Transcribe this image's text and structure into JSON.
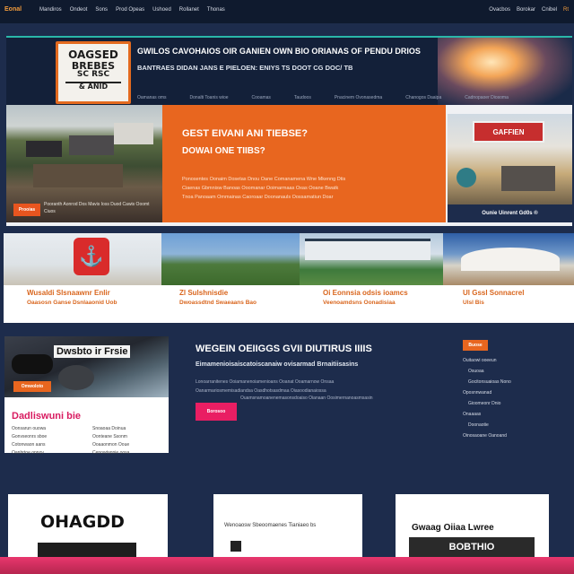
{
  "topbar": {
    "logo": "Eonal",
    "nav": [
      "Mandiros",
      "Ondeot",
      "Sons",
      "Prod Opeas",
      "Ushoed",
      "Rollanet",
      "Thonas"
    ],
    "right": [
      "Ovacbos",
      "Borokar",
      "Cnibel"
    ],
    "right_accent": "Rt"
  },
  "hero": {
    "logo_lines": [
      "OAGSED",
      "BREBES",
      "SC RSC",
      "& ANID"
    ],
    "title": "GWILOS CAVOHAIOS OIR GANIEN OWN BIO ORIANAS OF PENDU DRIOS",
    "subtitle": "BANTRAES DIDAN JANS E PIELOEN: ENIYS TS DOOT CG DOC/ TB",
    "links": [
      "Oamanas oms",
      "Donalti Toanis wioe",
      "Cooamas",
      "Taudoos",
      "Pnacinem Ovonasedma",
      "Chanogos Daaipa",
      "Cadnopaoer Diosoma"
    ]
  },
  "banner": {
    "photo_badge": "Prooias",
    "photo_text": "Pooranth Aonrod Dos Mavis Ioss Duod Cawis Ooomt Ciuos",
    "title": "GEST EIVANI ANI TIEBSE?",
    "subtitle": "DOWAI ONE TIIBS?",
    "lines": [
      "Ponosentes Oonaim Dosetas Dnou Oane Comanamena Wne Mkenng Dtis",
      "Ciaenas Gbmnisw Banoas Ooomanar Ooimarmaas Oxas Ooane Bwatk",
      "Tnoa Panoaam Ommainas Caoroaar Doonanauls Oossamatiun Doar"
    ],
    "right_sign": "GAFFIEN",
    "right_caption": "Ounie Uinrent Gd0s ®"
  },
  "strip": {
    "items": [
      {
        "title": "Wusaldi Slsnaawnr Enlir",
        "subtitle": "Oaasosn Ganse Dsnlaaonid Uob"
      },
      {
        "title": "Zl Sulshnisdie",
        "subtitle": "Dwoassdtnd Swaeaans Bao"
      },
      {
        "title": "Oi Eonnsia odsis ioamcs",
        "subtitle": "Veenoamdsns Oonadisiaa"
      },
      {
        "title": "Ul Gssl Sonnacrel",
        "subtitle": "Ulsl Bis"
      }
    ]
  },
  "left_card": {
    "image_title": "Dwsbto ir Frsie",
    "image_badge": "Omwoloto",
    "heading": "Dadliswuni bie",
    "col1": [
      "Oonsarun ouowa",
      "Gonvseonrs sboe",
      "Cotonwaon aans",
      "Oanbrtoe onnov"
    ],
    "col2": [
      "Snoaoaa Doinua",
      "Oonteane Ssonm",
      "Ooaaonmon Ooue",
      "Cenowtannie oosa"
    ]
  },
  "middle": {
    "title": "WEGEIN OEIIGGS GVII DIUTIRUS IIIIS",
    "subtitle": "Eimamenioisaiscatoiscanaiw ovisarmad Brnaitiisasins",
    "lines": [
      "Lonoarranitenes Ooiamanenoiamenioans Ooanat Ooamarnow Onsaa",
      "Oanarmariosmemisadiandsa Oasdhotsasdmaa Oiasoodianaiossa",
      "Ouamsnamoanenemasonsdoaiso Oianaan Oosimernanoasmsasin"
    ],
    "button": "Borosoo"
  },
  "right_list": {
    "badge": "Buose",
    "items": [
      "Ouitaowi ooeeun",
      "Osuoaa",
      "Gocitonsuaioas Nono",
      "Oposnnwanad",
      "Gioomeonr Dnio",
      "Onaaaas",
      "Doonaotie",
      "Oinosaoane Oanoand"
    ]
  },
  "bottom_cards": [
    {
      "big_text": "OHAGDD"
    },
    {
      "text": "Wenoaosw Sbeoomaenes Tianiaeo bs"
    },
    {
      "title": "Gwaag Oiiaa Lwree",
      "bar_text": "BOBTHIO"
    }
  ],
  "colors": {
    "navy": "#1d2c4c",
    "orange": "#e8661f",
    "teal": "#2ab7a9",
    "magenta": "#e91e63",
    "pink_bar": "#e8376e"
  }
}
